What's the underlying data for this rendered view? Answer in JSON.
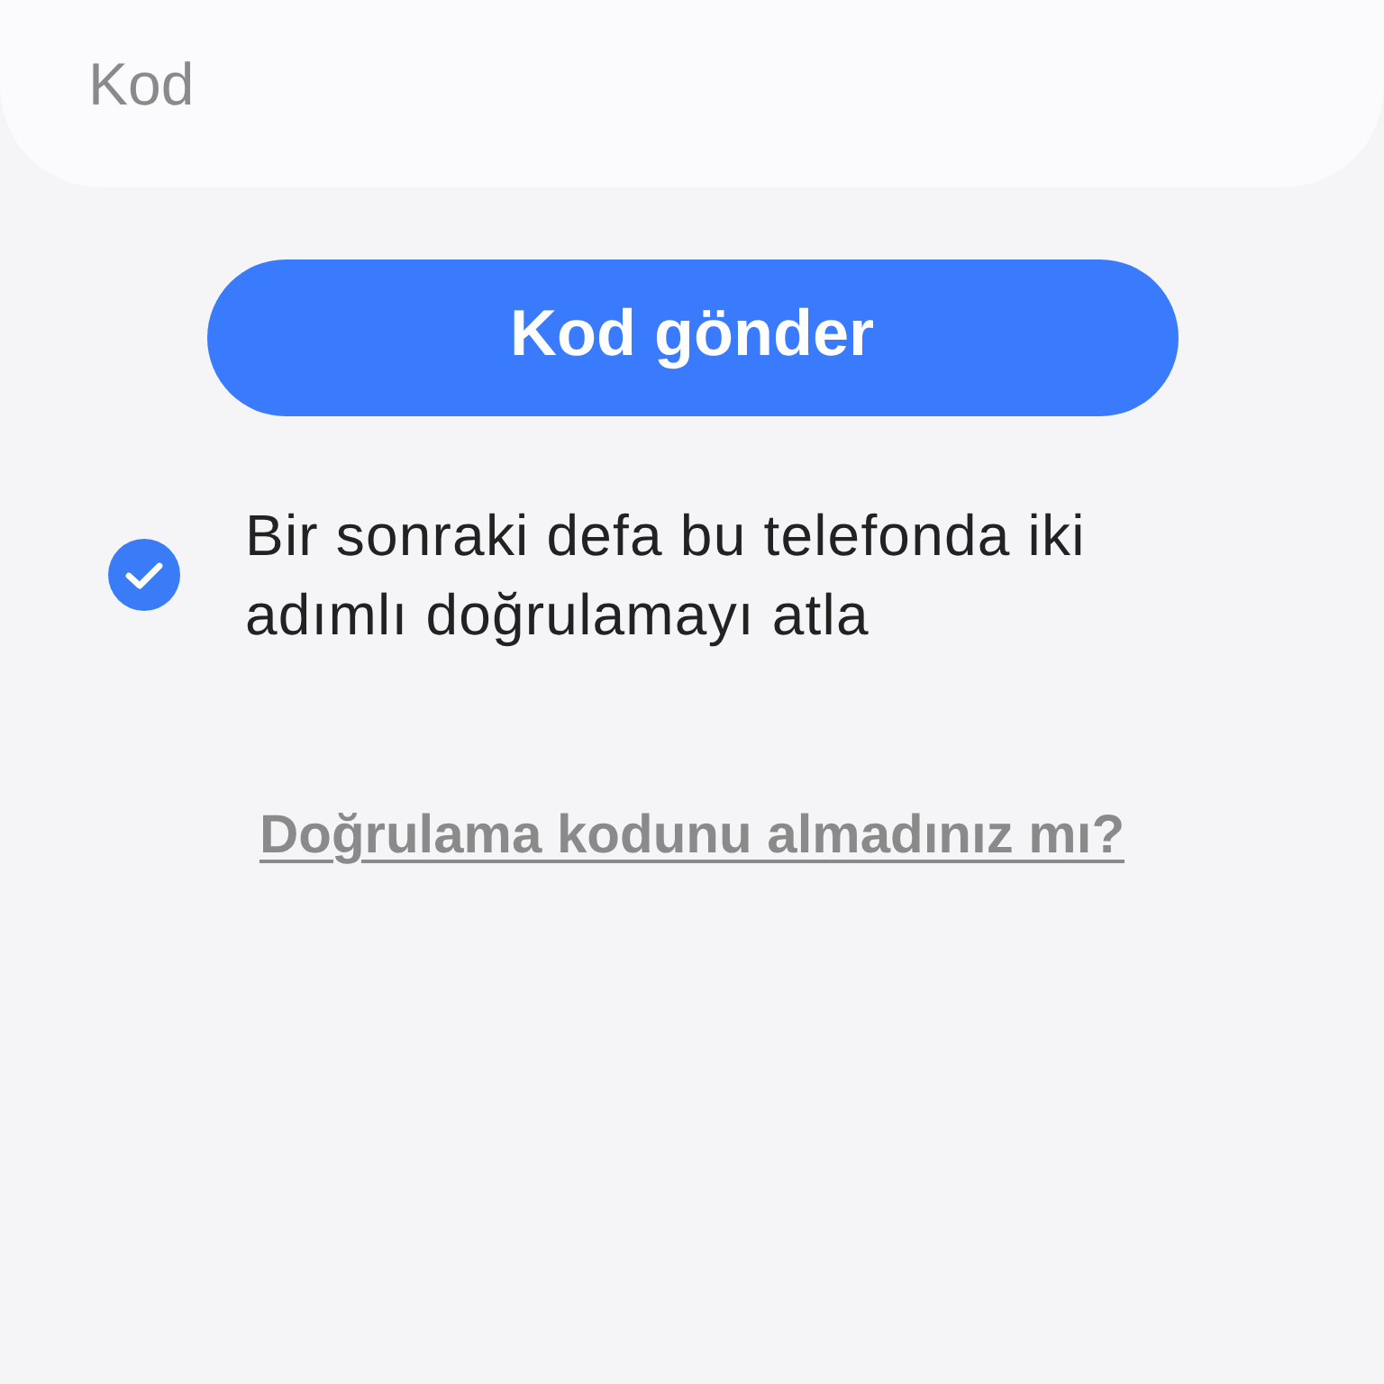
{
  "code_field": {
    "placeholder": "Kod"
  },
  "send_button": {
    "label": "Kod gönder"
  },
  "skip_option": {
    "label": "Bir sonraki defa bu telefonda iki adımlı doğrulamayı atla",
    "checked": true
  },
  "help_link": {
    "label": "Doğrulama kodunu almadınız mı?"
  }
}
